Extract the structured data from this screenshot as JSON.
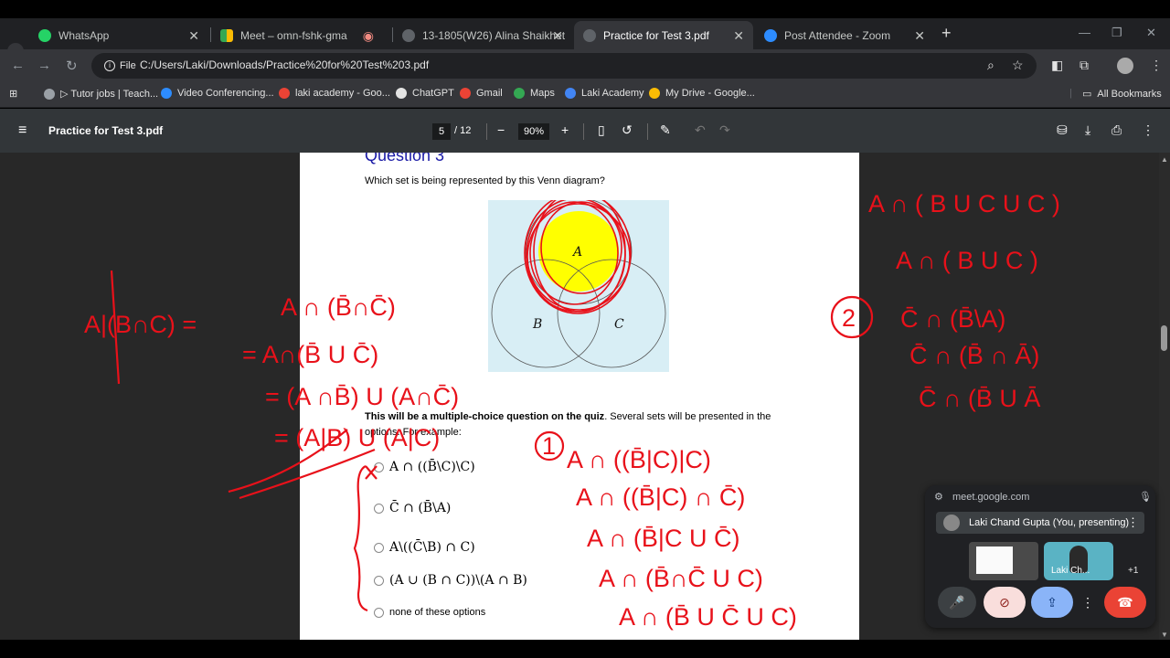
{
  "browser": {
    "tabs": [
      {
        "label": "WhatsApp",
        "icon": "whatsapp-icon",
        "active": false
      },
      {
        "label": "Meet – omn-fshk-gma",
        "icon": "meet-icon",
        "active": false
      },
      {
        "label": "13-1805(W26) Alina Shaikhet",
        "icon": "globe-icon",
        "active": false
      },
      {
        "label": "Practice for Test 3.pdf",
        "icon": "globe-icon",
        "active": true
      },
      {
        "label": "Post Attendee - Zoom",
        "icon": "zoom-icon",
        "active": false
      }
    ],
    "address": {
      "scheme_label": "File",
      "url": "C:/Users/Laki/Downloads/Practice%20for%20Test%203.pdf"
    },
    "bookmarks": [
      {
        "label": "▷ Tutor jobs | Teach...",
        "icon": "tutor-icon",
        "color": "#9aa0a6"
      },
      {
        "label": "Video Conferencing...",
        "icon": "zoom-icon",
        "color": "#2d8cff"
      },
      {
        "label": "laki academy - Goo...",
        "icon": "google-icon",
        "color": "#ea4335"
      },
      {
        "label": "ChatGPT",
        "icon": "chatgpt-icon",
        "color": "#e3e3e3"
      },
      {
        "label": "Gmail",
        "icon": "gmail-icon",
        "color": "#ea4335"
      },
      {
        "label": "Maps",
        "icon": "maps-icon",
        "color": "#34a853"
      },
      {
        "label": "Laki Academy",
        "icon": "laki-icon",
        "color": "#4285f4"
      },
      {
        "label": "My Drive - Google...",
        "icon": "drive-icon",
        "color": "#fbbc04"
      }
    ],
    "all_bookmarks": "All Bookmarks"
  },
  "pdf": {
    "title": "Practice for Test 3.pdf",
    "page": "5",
    "total": "/ 12",
    "zoom": "90%"
  },
  "document": {
    "heading": "Question 3",
    "question": "Which set is being represented by this Venn diagram?",
    "venn_labels": {
      "a": "A",
      "b": "B",
      "c": "C"
    },
    "mcq_bold": "This will be a multiple-choice question on the quiz",
    "mcq_rest": ". Several sets will be presented in the options. For example:",
    "options": [
      "A ∩ ((B̄\\C)\\C)",
      "C̄ ∩ (B̄\\A)",
      "A\\((C̄\\B) ∩ C)",
      "(A ∪ (B ∩ C))\\(A ∩ B)",
      "none of these options"
    ]
  },
  "annotations": {
    "left": [
      "A|(B∩C) =",
      "A ∩ (B̄∩C̄)",
      "= A∩(B̄ U C̄)",
      "= (A ∩B̄) U (A∩C̄)",
      "= (A|B) U (A|C)"
    ],
    "right_top": [
      "A ∩ ( B U C U C )",
      "A ∩ ( B U C )"
    ],
    "circle2": "2",
    "right_mid": [
      "C̄  ∩ (B̄\\A)",
      "C̄  ∩ (B̄ ∩ Ā)",
      "C̄  ∩ (B̄ U Ā"
    ],
    "circle1": "1",
    "bottom": [
      "A ∩ ((B̄|C)|C)",
      "A ∩ ((B̄|C) ∩ C̄)",
      "A ∩ (B̄|C U C̄)",
      "A ∩ (B̄∩C̄ U C)",
      "A ∩ (B̄ U C̄ U C)"
    ]
  },
  "meet": {
    "url": "meet.google.com",
    "presenter": "Laki Chand Gupta (You, presenting)",
    "tile_label": "Laki Ch...",
    "extra": "+1"
  },
  "colors": {
    "ink": "#e8111a",
    "highlight": "#ffff00",
    "venn_bg": "#d8eef5",
    "heading": "#1a1aa6"
  }
}
